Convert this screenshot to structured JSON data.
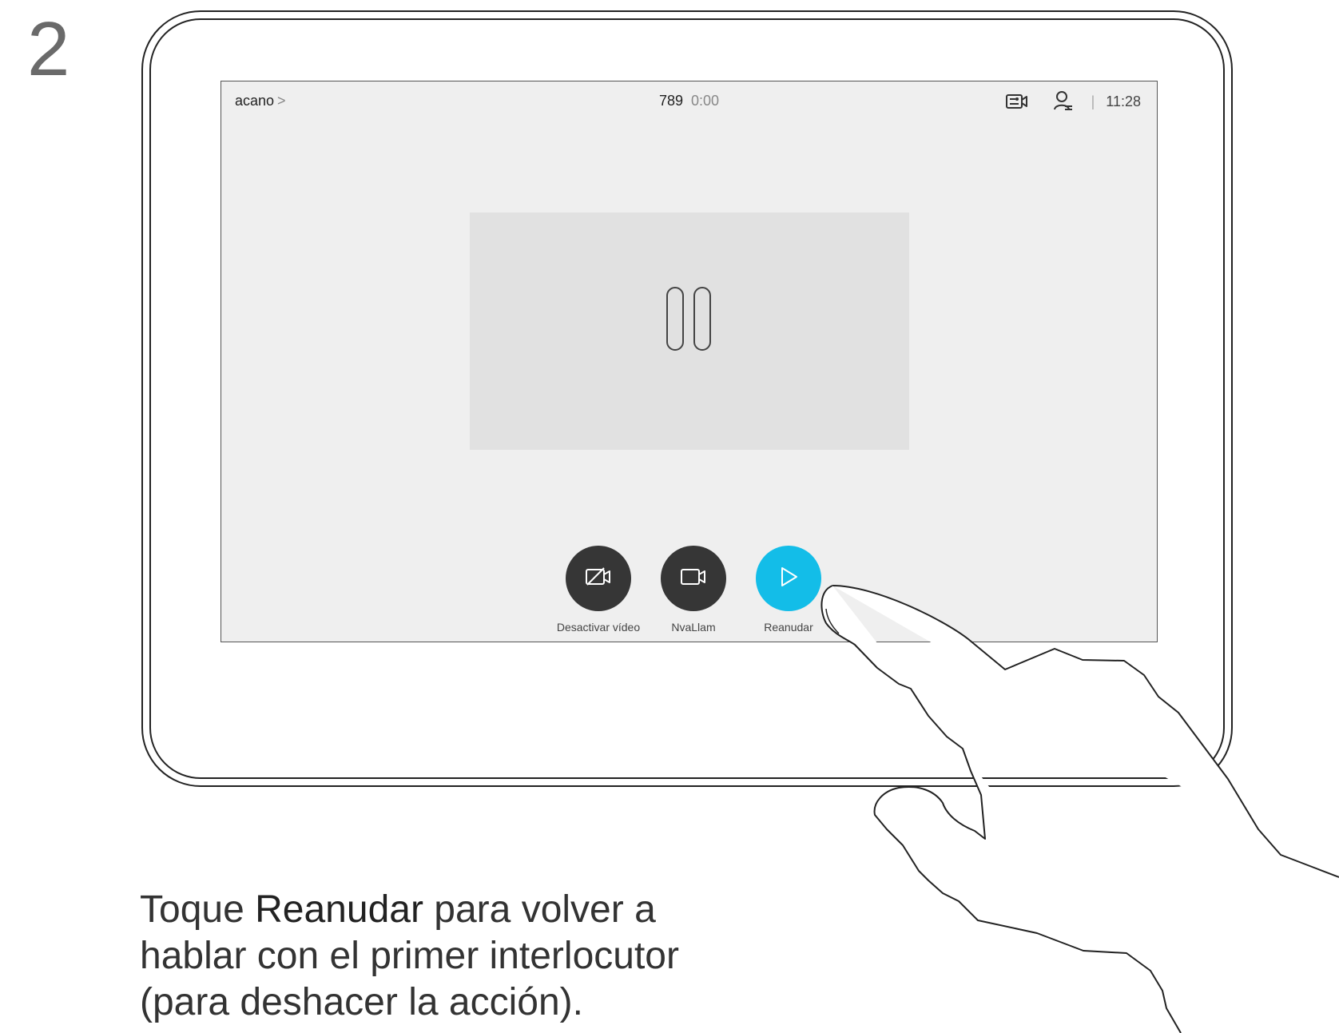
{
  "step": "2",
  "call": {
    "caller_name": "acano",
    "caller_chevron": ">",
    "number": "789",
    "duration": "0:00",
    "separator": "|",
    "clock": "11:28",
    "icons": [
      "share-screen-icon",
      "participants-icon"
    ]
  },
  "video": {
    "state_icon": "pause-icon"
  },
  "controls": [
    {
      "label": "Desactivar vídeo",
      "icon": "video-off-icon",
      "color": "#363636"
    },
    {
      "label": "NvaLlam",
      "icon": "video-camera-icon",
      "color": "#363636"
    },
    {
      "label": "Reanudar",
      "icon": "play-icon",
      "color": "#13bde8"
    }
  ],
  "instruction": {
    "prefix": "Toque ",
    "bold": "Reanudar",
    "suffix_line1": " para volver a",
    "line2": "hablar con el primer interlocutor",
    "line3": "(para deshacer la acción)."
  }
}
